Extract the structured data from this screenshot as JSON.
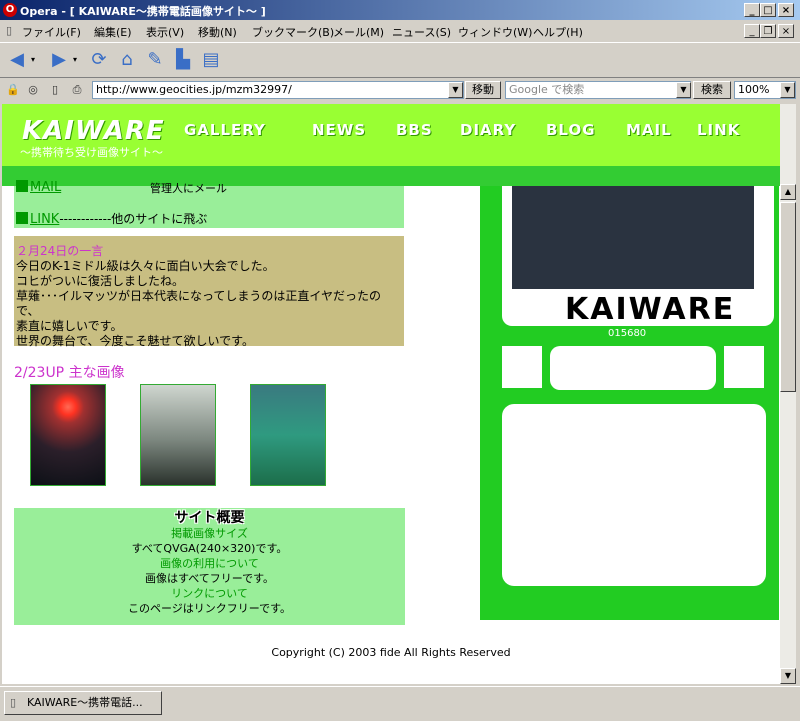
{
  "window": {
    "title": "Opera - [ KAIWARE～携帯電話画像サイト～ ]",
    "minimize": "_",
    "maximize": "□",
    "close": "×"
  },
  "menu": [
    "ファイル(F)",
    "編集(E)",
    "表示(V)",
    "移動(N)",
    "ブックマーク(B)",
    "メール(M)",
    "ニュース(S)",
    "ウィンドウ(W)",
    "ヘルプ(H)"
  ],
  "address": {
    "url": "http://www.geocities.jp/mzm32997/",
    "go_label": "移動",
    "search_placeholder": "Google で検索",
    "search_label": "検索",
    "zoom": "100%"
  },
  "site": {
    "logo": "KAIWARE",
    "tagline": "～携帯待ち受け画像サイト～",
    "nav": [
      "GALLERY",
      "NEWS",
      "BBS",
      "DIARY",
      "BLOG",
      "MAIL",
      "LINK"
    ],
    "mail_partial": "MAIL",
    "mail_desc": "管理人にメール",
    "link_label": "LINK",
    "link_dashes": "------------",
    "link_desc": "他のサイトに飛ぶ",
    "news": {
      "title": "２月24日の一言",
      "lines": [
        "今日のK-1ミドル級は久々に面白い大会でした。",
        "コヒがついに復活しましたね。",
        "草薙･･･イルマッツが日本代表になってしまうのは正直イヤだったので、",
        "素直に嬉しいです。",
        "世界の舞台で、今度こそ魅せて欲しいです。"
      ]
    },
    "images_title": "2/23UP 主な画像",
    "about": {
      "heading": "サイト概要",
      "items": [
        {
          "label": "掲載画像サイズ",
          "text": "すべてQVGA(240×320)です。"
        },
        {
          "label": "画像の利用について",
          "text": "画像はすべてフリーです。"
        },
        {
          "label": "リンクについて",
          "text": "このページはリンクフリーです。"
        }
      ]
    },
    "phone_logo": "KAIWARE",
    "counter": "015680",
    "copyright": "Copyright (C) 2003 fide All Rights Reserved"
  },
  "taskbar": {
    "item": "KAIWARE～携帯電話..."
  }
}
